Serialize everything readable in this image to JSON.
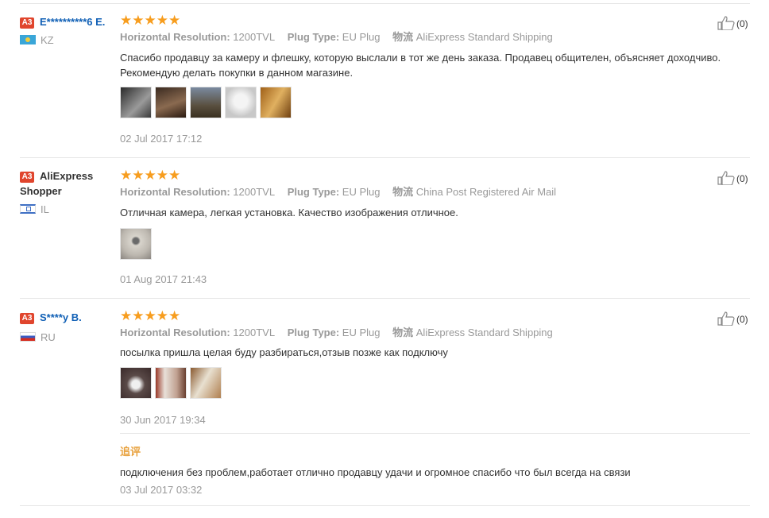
{
  "reviews": [
    {
      "badge": "A3",
      "name": "E**********6 E.",
      "country": "KZ",
      "flag_colors": [
        "#3aa6d8",
        "#f3cd3c"
      ],
      "stars": "★★★★★",
      "props": [
        {
          "key": "Horizontal Resolution:",
          "value": "1200TVL"
        },
        {
          "key": "Plug Type:",
          "value": "EU Plug"
        },
        {
          "key": "物流",
          "value": "AliExpress Standard Shipping"
        }
      ],
      "text": "Спасибо продавцу за камеру и флешку, которую выслали в тот же день заказа. Продавец общителен, объясняет доходчиво. Рекомендую делать покупки в данном магазине.",
      "photo_colors": [
        "#3a3a3a",
        "#5a4030",
        "#6a6050",
        "#d8d8d8",
        "#c88a2a"
      ],
      "date": "02 Jul 2017 17:12",
      "likes": "(0)"
    },
    {
      "badge": "A3",
      "name": "AliExpress Shopper",
      "country": "IL",
      "flag_colors": [
        "#ffffff",
        "#3f70c4"
      ],
      "stars": "★★★★★",
      "props": [
        {
          "key": "Horizontal Resolution:",
          "value": "1200TVL"
        },
        {
          "key": "Plug Type:",
          "value": "EU Plug"
        },
        {
          "key": "物流",
          "value": "China Post Registered Air Mail"
        }
      ],
      "text": "Отличная камера, легкая установка. Качество изображения отличное.",
      "photo_colors": [
        "#bdb8b0"
      ],
      "date": "01 Aug 2017 21:43",
      "likes": "(0)"
    },
    {
      "badge": "A3",
      "name": "S****y B.",
      "country": "RU",
      "flag_colors": [
        "#ffffff",
        "#3a5cc4",
        "#d52b1e"
      ],
      "stars": "★★★★★",
      "props": [
        {
          "key": "Horizontal Resolution:",
          "value": "1200TVL"
        },
        {
          "key": "Plug Type:",
          "value": "EU Plug"
        },
        {
          "key": "物流",
          "value": "AliExpress Standard Shipping"
        }
      ],
      "text": "посылка пришла целая буду разбираться,отзыв позже как подключу",
      "photo_colors": [
        "#6a5a55",
        "#b0928a",
        "#a07a50"
      ],
      "date": "30 Jun 2017 19:34",
      "likes": "(0)",
      "followup": {
        "title": "追评",
        "text": "подключения без проблем,работает отлично продавцу удачи и огромное спасибо что был всегда на связи",
        "date": "03 Jul 2017 03:32"
      }
    }
  ],
  "colors": {
    "accent_star": "#f79d1e",
    "link": "#0f5fb5",
    "badge": "#e0452d",
    "followup": "#e8a13d"
  }
}
